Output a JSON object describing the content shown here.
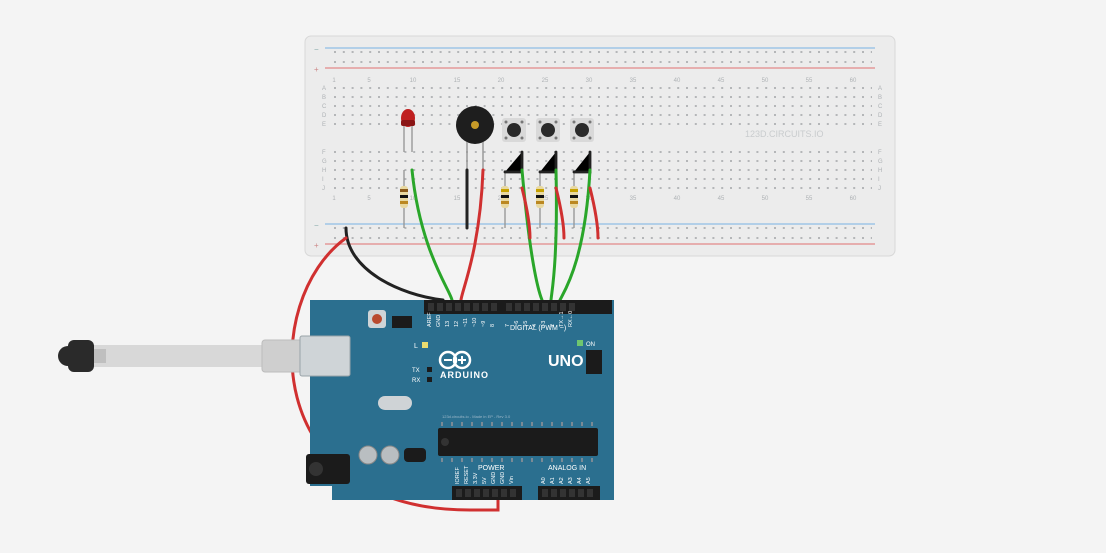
{
  "watermark": "123D.CIRCUITS.IO",
  "breadboard": {
    "rows_top": [
      "A",
      "B",
      "C",
      "D",
      "E"
    ],
    "rows_bottom": [
      "F",
      "G",
      "H",
      "I",
      "J"
    ],
    "columns": [
      1,
      5,
      10,
      15,
      20,
      25,
      30,
      35,
      40,
      45,
      50,
      55,
      60
    ],
    "power_labels": {
      "plus": "+",
      "minus": "−"
    }
  },
  "arduino": {
    "brand": "ARDUINO",
    "model": "UNO",
    "logo": "∞",
    "section_digital": "DIGITAL (PWM ~)",
    "section_power": "POWER",
    "section_analog": "ANALOG IN",
    "label_on": "ON",
    "label_L": "L",
    "label_TX": "TX",
    "label_RX": "RX",
    "footer": "123d.circuits.io - Made in EP - Rev 3.0",
    "pins_digital": [
      "AREF",
      "GND",
      "13",
      "12",
      "~11",
      "~10",
      "~9",
      "8",
      "7",
      "~6",
      "~5",
      "4",
      "~3",
      "2",
      "TX→1",
      "RX←0"
    ],
    "pins_power": [
      "IOREF",
      "RESET",
      "3.3V",
      "5V",
      "GND",
      "GND",
      "Vin"
    ],
    "pins_analog": [
      "A0",
      "A1",
      "A2",
      "A3",
      "A4",
      "A5"
    ]
  },
  "components": {
    "led_color": "#c02020",
    "buzzer_color": "#1e1e1e",
    "button_count": 3
  },
  "wires": {
    "green": "#2aa62a",
    "red": "#d03030",
    "black": "#222"
  }
}
